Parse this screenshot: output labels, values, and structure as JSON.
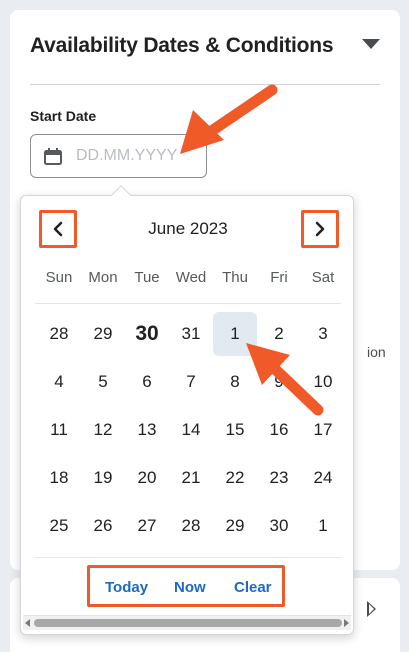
{
  "card": {
    "title": "Availability Dates & Conditions",
    "start_date_label": "Start Date",
    "date_input_placeholder": "DD.MM.YYYY",
    "background_text_fragment": "ion"
  },
  "calendar": {
    "month_title": "June 2023",
    "weekdays": [
      "Sun",
      "Mon",
      "Tue",
      "Wed",
      "Thu",
      "Fri",
      "Sat"
    ],
    "weeks": [
      [
        "28",
        "29",
        "30",
        "31",
        "1",
        "2",
        "3"
      ],
      [
        "4",
        "5",
        "6",
        "7",
        "8",
        "9",
        "10"
      ],
      [
        "11",
        "12",
        "13",
        "14",
        "15",
        "16",
        "17"
      ],
      [
        "18",
        "19",
        "20",
        "21",
        "22",
        "23",
        "24"
      ],
      [
        "25",
        "26",
        "27",
        "28",
        "29",
        "30",
        "1"
      ]
    ],
    "footer": {
      "today": "Today",
      "now": "Now",
      "clear": "Clear"
    }
  },
  "icons": [
    "calendar-icon",
    "chevron-left-icon",
    "chevron-right-icon",
    "caret-down-icon",
    "caret-right-icon"
  ],
  "colors": {
    "annotation": "#f05a28",
    "link": "#1b6ac9",
    "selected_day_bg": "#e3e9f1",
    "placeholder": "#b9bdc2"
  }
}
